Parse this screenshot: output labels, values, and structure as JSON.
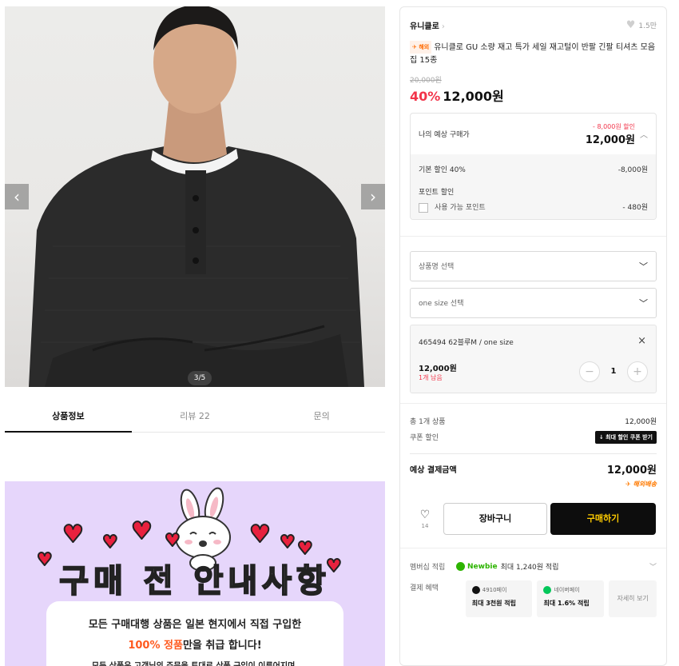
{
  "gallery": {
    "counter": "3/5",
    "prev_icon": "chevron-left-icon",
    "next_icon": "chevron-right-icon"
  },
  "tabs": [
    {
      "label": "상품정보"
    },
    {
      "label": "리뷰 22"
    },
    {
      "label": "문의"
    }
  ],
  "notice": {
    "title": "구매 전 안내사항",
    "line1": "모든 구매대행 상품은 일본 현지에서 직접 구입한",
    "line2_highlight": "100% 정품",
    "line2_rest": "만을 취급 합니다!",
    "line3": "모든 상품은 고객님의 주문을 토대로 상품 구입이 이루어지며,"
  },
  "product": {
    "brand": "유니클로",
    "likes": "1.5만",
    "ship_tag": "해외",
    "title": "유니클로 GU 소량 재고 특가 세일 재고털이 반팔 긴팔 티셔츠 모음집 15종",
    "original_price": "20,000원",
    "discount_rate": "40%",
    "price": "12,000원"
  },
  "estimate": {
    "label": "나의 예상 구매가",
    "discount": "- 8,000원 할인",
    "final": "12,000원",
    "base_label": "기본 할인 40%",
    "base_value": "-8,000원",
    "point_label": "포인트 할인",
    "point_check_label": "사용 가능 포인트",
    "point_value": "- 480원"
  },
  "options": {
    "select1": "상품명 선택",
    "select2": "one size 선택",
    "selected_name": "465494 62블루M / one size",
    "selected_price": "12,000원",
    "stock_left": "1개 남음",
    "quantity": "1",
    "minus": "−",
    "plus": "+",
    "remove": "×"
  },
  "summary": {
    "total_label": "총 1개 상품",
    "total_value": "12,000원",
    "coupon_label": "쿠폰 할인",
    "coupon_button": "↓ 최대 할인 쿠폰 받기",
    "pay_label": "예상 결제금액",
    "pay_value": "12,000원",
    "overseas": "✈ 해외배송"
  },
  "actions": {
    "wish_count": "14",
    "cart": "장바구니",
    "buy": "구매하기"
  },
  "membership": {
    "label": "멤버십 적립",
    "tier": "Newbie",
    "benefit": "최대 1,240원 적립"
  },
  "payment": {
    "label": "결제 혜택",
    "cards": [
      {
        "name": "4910페이",
        "benefit": "최대 3천원 적립",
        "color": "#111111"
      },
      {
        "name": "네이버페이",
        "benefit": "최대 1.6% 적립",
        "color": "#03c75a"
      }
    ],
    "more": "자세히 보기"
  },
  "colors": {
    "accent_red": "#f2344a",
    "buy_text": "#ffcc00",
    "notice_bg": "#e6d6fb"
  }
}
